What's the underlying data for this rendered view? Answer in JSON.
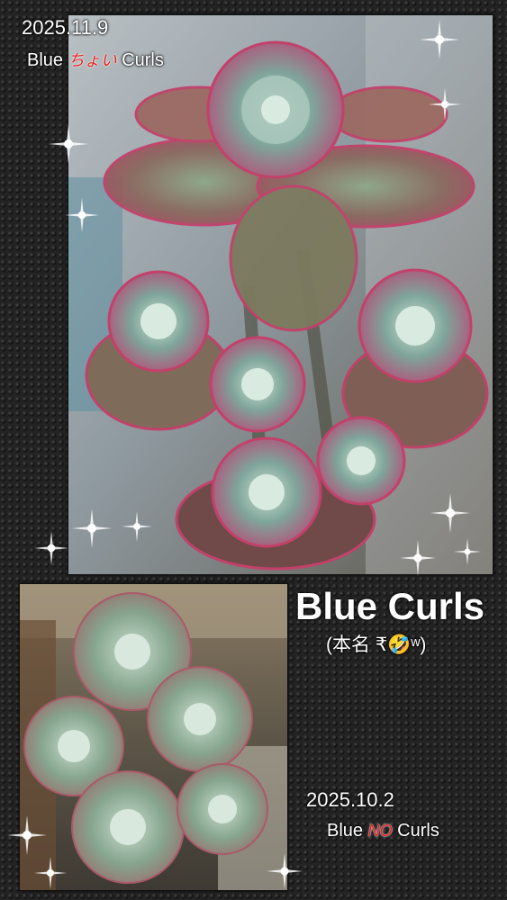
{
  "top_photo": {
    "date": "2025.11.9",
    "caption_prefix": "Blue",
    "caption_middle": "ちょい",
    "caption_suffix": "Curls"
  },
  "title": "Blue Curls",
  "subtitle": "(本名 ₹🤣ʷ)",
  "bottom_photo": {
    "date": "2025.10.2",
    "caption_prefix": "Blue",
    "caption_middle": "NO",
    "caption_suffix": "Curls"
  },
  "colors": {
    "background": "#232323",
    "text": "#ffffff",
    "accent_red": "#e61e1e"
  }
}
